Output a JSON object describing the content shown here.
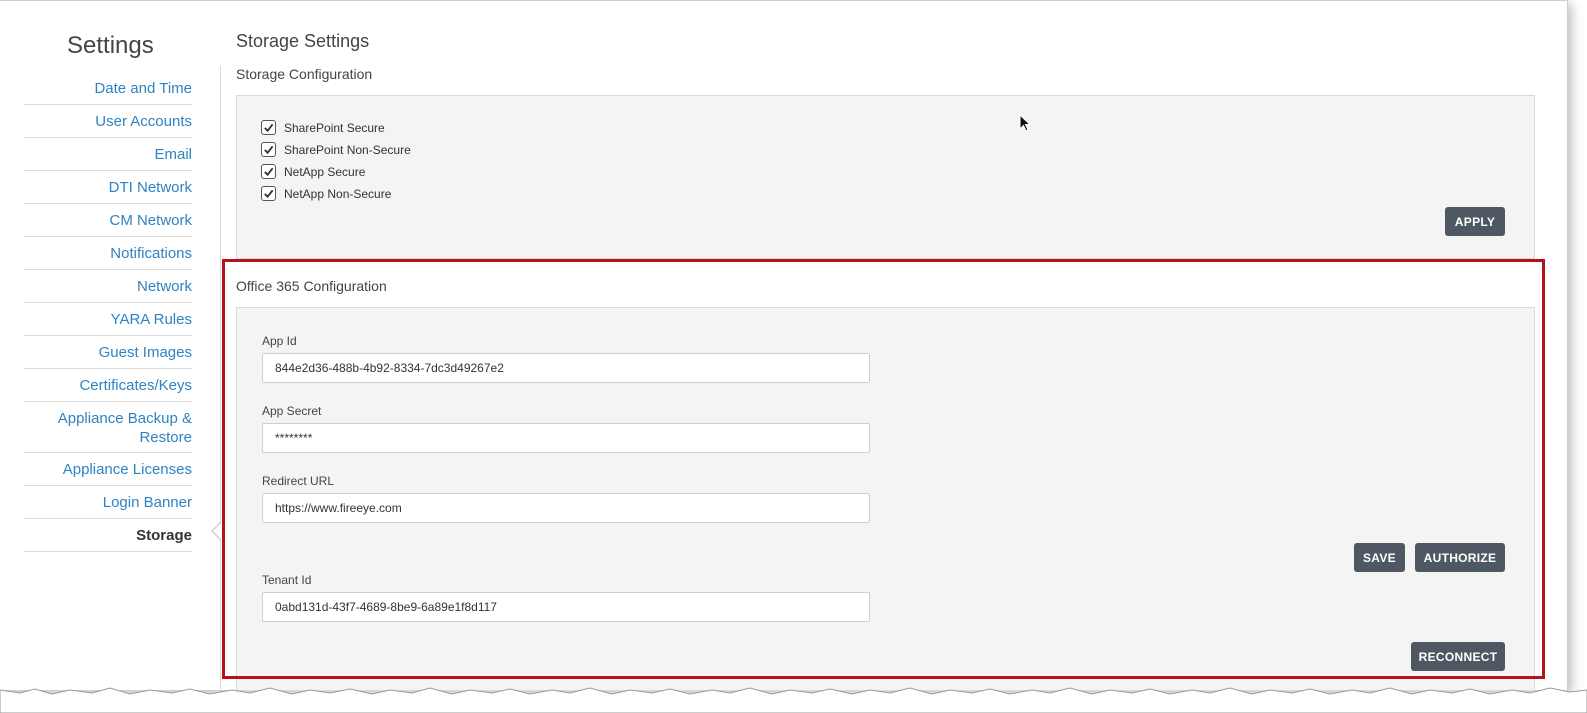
{
  "sidebar": {
    "title": "Settings",
    "items": [
      {
        "label": "Date and Time"
      },
      {
        "label": "User Accounts"
      },
      {
        "label": "Email"
      },
      {
        "label": "DTI Network"
      },
      {
        "label": "CM Network"
      },
      {
        "label": "Notifications"
      },
      {
        "label": "Network"
      },
      {
        "label": "YARA Rules"
      },
      {
        "label": "Guest Images"
      },
      {
        "label": "Certificates/Keys"
      },
      {
        "label": "Appliance Backup & Restore"
      },
      {
        "label": "Appliance Licenses"
      },
      {
        "label": "Login Banner"
      },
      {
        "label": "Storage"
      }
    ],
    "active_item": "Storage"
  },
  "main": {
    "title": "Storage Settings",
    "storage_config": {
      "title": "Storage Configuration",
      "options": [
        {
          "label": "SharePoint Secure",
          "checked": true
        },
        {
          "label": "SharePoint Non-Secure",
          "checked": true
        },
        {
          "label": "NetApp Secure",
          "checked": true
        },
        {
          "label": "NetApp Non-Secure",
          "checked": true
        }
      ],
      "apply_label": "APPLY"
    },
    "office365": {
      "title": "Office 365 Configuration",
      "app_id": {
        "label": "App Id",
        "value": "844e2d36-488b-4b92-8334-7dc3d49267e2"
      },
      "app_secret": {
        "label": "App Secret",
        "value": "********"
      },
      "redirect_url": {
        "label": "Redirect URL",
        "value": "https://www.fireeye.com"
      },
      "tenant_id": {
        "label": "Tenant Id",
        "value": "0abd131d-43f7-4689-8be9-6a89e1f8d117"
      },
      "save_label": "SAVE",
      "authorize_label": "AUTHORIZE",
      "reconnect_label": "RECONNECT"
    }
  },
  "colors": {
    "link": "#2f83c2",
    "button": "#4f5862",
    "highlight": "#b5121b",
    "panel": "#f4f4f4"
  }
}
